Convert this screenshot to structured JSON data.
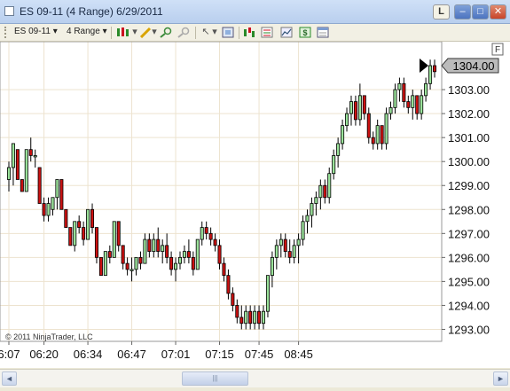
{
  "window": {
    "title": "ES 09-11 (4 Range)  6/29/2011",
    "buttons": {
      "layout": "L",
      "minimize": "–",
      "maximize": "□",
      "close": "✕"
    }
  },
  "toolbar": {
    "instrument": "ES 09-11",
    "interval": "4 Range",
    "icons": [
      "bar-type-icon",
      "pen-icon",
      "zoom-icon",
      "cursor-icon",
      "drawing-objects-icon",
      "indicators-icon",
      "strategies-icon",
      "dollar-icon",
      "properties-icon"
    ]
  },
  "scrollbar": {
    "left_arrow": "◄",
    "right_arrow": "►",
    "thumb": "|||"
  },
  "chart_data": {
    "type": "candlestick",
    "instrument": "ES 09-11",
    "interval": "4 Range",
    "date": "6/29/2011",
    "copyright": "© 2011 NinjaTrader, LLC",
    "last_price_label": "1304.00",
    "last_price": 1304.0,
    "panel_label": "F",
    "ylim": [
      1292.5,
      1305.0
    ],
    "y_ticks": [
      "1293.00",
      "1294.00",
      "1295.00",
      "1296.00",
      "1297.00",
      "1298.00",
      "1299.00",
      "1300.00",
      "1301.00",
      "1302.00",
      "1303.00"
    ],
    "x_ticks": [
      {
        "label": "6:07",
        "bar": 0
      },
      {
        "label": "06:20",
        "bar": 8
      },
      {
        "label": "06:34",
        "bar": 18
      },
      {
        "label": "06:47",
        "bar": 28
      },
      {
        "label": "07:01",
        "bar": 38
      },
      {
        "label": "07:15",
        "bar": 48
      },
      {
        "label": "07:45",
        "bar": 57
      },
      {
        "label": "08:45",
        "bar": 66
      }
    ],
    "colors": {
      "up": "#9be39b",
      "down": "#cc1111",
      "outline": "#000000",
      "grid": "#ede3cf",
      "price_marker": "#bbbbbb"
    },
    "candles": [
      [
        1299.25,
        1300.0,
        1298.75,
        1299.75
      ],
      [
        1299.75,
        1300.75,
        1299.0,
        1300.75
      ],
      [
        1300.5,
        1300.5,
        1299.25,
        1299.25
      ],
      [
        1299.25,
        1299.25,
        1298.75,
        1298.75
      ],
      [
        1298.75,
        1300.5,
        1298.75,
        1300.5
      ],
      [
        1300.5,
        1301.0,
        1300.0,
        1300.25
      ],
      [
        1300.25,
        1300.5,
        1299.75,
        1300.25
      ],
      [
        1299.75,
        1299.75,
        1298.25,
        1298.25
      ],
      [
        1298.25,
        1298.5,
        1297.5,
        1297.75
      ],
      [
        1297.75,
        1298.5,
        1297.5,
        1298.25
      ],
      [
        1298.0,
        1298.5,
        1297.75,
        1298.5
      ],
      [
        1298.5,
        1299.25,
        1298.0,
        1299.25
      ],
      [
        1299.25,
        1299.25,
        1298.0,
        1298.0
      ],
      [
        1298.0,
        1298.0,
        1297.25,
        1297.25
      ],
      [
        1297.25,
        1297.25,
        1296.5,
        1296.5
      ],
      [
        1296.5,
        1297.5,
        1296.25,
        1297.5
      ],
      [
        1297.5,
        1297.75,
        1297.0,
        1297.25
      ],
      [
        1297.25,
        1297.5,
        1296.5,
        1296.75
      ],
      [
        1296.75,
        1298.0,
        1296.75,
        1298.0
      ],
      [
        1298.0,
        1298.25,
        1297.0,
        1297.25
      ],
      [
        1297.25,
        1297.25,
        1295.75,
        1296.0
      ],
      [
        1296.0,
        1296.0,
        1295.25,
        1295.25
      ],
      [
        1295.25,
        1296.25,
        1295.25,
        1296.25
      ],
      [
        1296.25,
        1296.5,
        1295.75,
        1296.0
      ],
      [
        1296.0,
        1297.5,
        1296.0,
        1297.5
      ],
      [
        1297.5,
        1297.5,
        1296.25,
        1296.5
      ],
      [
        1296.5,
        1296.5,
        1295.5,
        1295.75
      ],
      [
        1295.75,
        1296.0,
        1295.25,
        1295.5
      ],
      [
        1295.5,
        1296.0,
        1295.0,
        1295.5
      ],
      [
        1295.5,
        1296.0,
        1295.25,
        1296.0
      ],
      [
        1296.0,
        1296.25,
        1295.5,
        1295.75
      ],
      [
        1295.75,
        1297.0,
        1295.75,
        1296.75
      ],
      [
        1296.75,
        1297.0,
        1296.0,
        1296.25
      ],
      [
        1296.25,
        1297.0,
        1296.0,
        1296.75
      ],
      [
        1296.75,
        1297.25,
        1296.0,
        1296.25
      ],
      [
        1296.25,
        1296.75,
        1295.75,
        1296.5
      ],
      [
        1296.5,
        1297.0,
        1295.75,
        1296.0
      ],
      [
        1296.0,
        1296.25,
        1295.25,
        1295.5
      ],
      [
        1295.5,
        1296.0,
        1295.0,
        1295.75
      ],
      [
        1295.75,
        1296.25,
        1295.5,
        1296.0
      ],
      [
        1296.0,
        1296.5,
        1295.75,
        1296.25
      ],
      [
        1296.25,
        1296.75,
        1295.75,
        1296.0
      ],
      [
        1296.0,
        1296.25,
        1295.25,
        1295.5
      ],
      [
        1295.5,
        1296.75,
        1295.5,
        1296.75
      ],
      [
        1296.75,
        1297.5,
        1296.5,
        1297.25
      ],
      [
        1297.25,
        1297.5,
        1296.75,
        1297.0
      ],
      [
        1297.0,
        1297.25,
        1296.5,
        1296.75
      ],
      [
        1296.75,
        1297.0,
        1296.25,
        1296.5
      ],
      [
        1296.5,
        1296.75,
        1295.5,
        1295.75
      ],
      [
        1295.75,
        1296.0,
        1295.0,
        1295.25
      ],
      [
        1295.25,
        1295.5,
        1294.25,
        1294.5
      ],
      [
        1294.5,
        1294.75,
        1293.75,
        1294.0
      ],
      [
        1294.0,
        1294.25,
        1293.25,
        1293.5
      ],
      [
        1293.5,
        1294.0,
        1293.0,
        1293.25
      ],
      [
        1293.25,
        1294.0,
        1293.0,
        1293.75
      ],
      [
        1293.75,
        1294.0,
        1293.0,
        1293.25
      ],
      [
        1293.25,
        1294.0,
        1293.0,
        1293.75
      ],
      [
        1293.75,
        1294.0,
        1293.0,
        1293.25
      ],
      [
        1293.25,
        1294.0,
        1293.0,
        1293.75
      ],
      [
        1293.75,
        1295.25,
        1293.5,
        1295.25
      ],
      [
        1295.25,
        1296.25,
        1294.75,
        1296.0
      ],
      [
        1296.0,
        1296.75,
        1295.5,
        1296.5
      ],
      [
        1296.5,
        1297.0,
        1296.0,
        1296.75
      ],
      [
        1296.75,
        1297.0,
        1296.0,
        1296.25
      ],
      [
        1296.25,
        1296.75,
        1295.75,
        1296.0
      ],
      [
        1296.0,
        1296.75,
        1295.75,
        1296.5
      ],
      [
        1296.5,
        1297.0,
        1295.75,
        1296.75
      ],
      [
        1296.75,
        1297.75,
        1296.5,
        1297.5
      ],
      [
        1297.5,
        1298.0,
        1297.0,
        1297.75
      ],
      [
        1297.75,
        1298.5,
        1297.25,
        1298.25
      ],
      [
        1298.25,
        1298.75,
        1297.75,
        1298.5
      ],
      [
        1298.5,
        1299.25,
        1298.0,
        1299.0
      ],
      [
        1299.0,
        1299.25,
        1298.25,
        1298.5
      ],
      [
        1298.5,
        1299.75,
        1298.25,
        1299.5
      ],
      [
        1299.5,
        1300.5,
        1299.25,
        1300.25
      ],
      [
        1300.25,
        1301.0,
        1299.75,
        1300.75
      ],
      [
        1300.75,
        1301.75,
        1300.5,
        1301.5
      ],
      [
        1301.5,
        1302.25,
        1301.25,
        1302.0
      ],
      [
        1302.0,
        1302.75,
        1301.5,
        1302.5
      ],
      [
        1302.5,
        1302.75,
        1301.5,
        1301.75
      ],
      [
        1301.75,
        1303.25,
        1301.5,
        1302.75
      ],
      [
        1302.75,
        1302.75,
        1301.75,
        1302.0
      ],
      [
        1302.0,
        1302.25,
        1300.75,
        1301.0
      ],
      [
        1301.0,
        1301.25,
        1300.5,
        1300.75
      ],
      [
        1300.75,
        1301.75,
        1300.5,
        1301.5
      ],
      [
        1301.5,
        1301.5,
        1300.5,
        1300.75
      ],
      [
        1300.75,
        1302.25,
        1300.5,
        1302.0
      ],
      [
        1302.0,
        1302.5,
        1301.75,
        1302.25
      ],
      [
        1302.25,
        1303.25,
        1302.0,
        1303.0
      ],
      [
        1303.0,
        1303.5,
        1302.5,
        1303.25
      ],
      [
        1303.25,
        1303.5,
        1302.25,
        1302.5
      ],
      [
        1302.5,
        1302.75,
        1302.0,
        1302.25
      ],
      [
        1302.25,
        1303.0,
        1301.75,
        1302.75
      ],
      [
        1302.75,
        1302.75,
        1301.75,
        1302.0
      ],
      [
        1302.0,
        1303.0,
        1301.75,
        1302.75
      ],
      [
        1302.75,
        1303.5,
        1302.5,
        1303.25
      ],
      [
        1303.25,
        1304.25,
        1303.0,
        1304.0
      ],
      [
        1304.0,
        1304.25,
        1303.5,
        1303.75
      ]
    ]
  }
}
